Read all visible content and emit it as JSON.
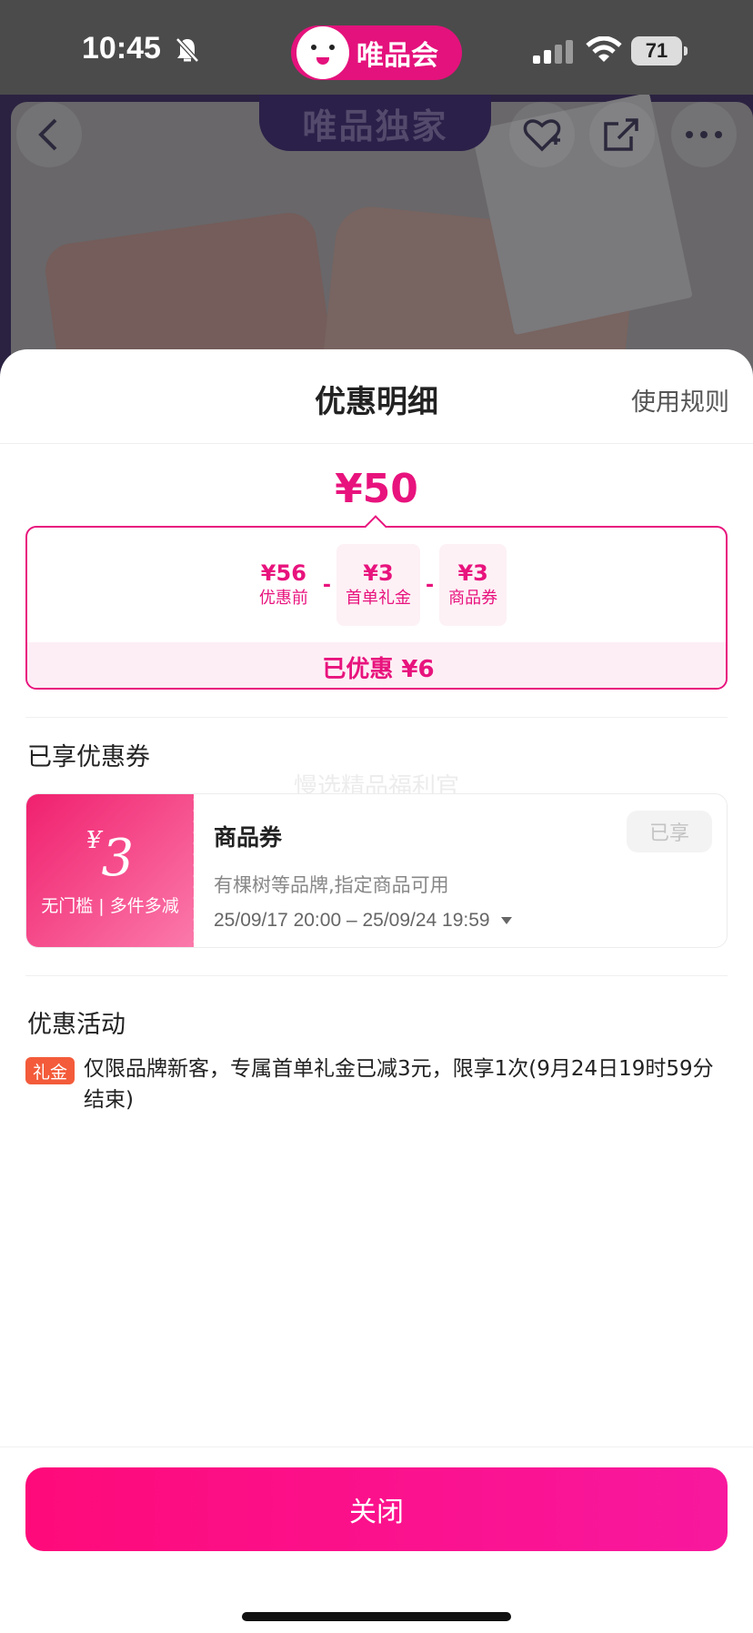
{
  "status_bar": {
    "time": "10:45",
    "app_name": "唯品会",
    "battery": "71"
  },
  "background_page": {
    "banner_tag": "唯品独家",
    "icons": [
      "back-icon",
      "favorite-add-icon",
      "share-icon",
      "more-icon"
    ]
  },
  "sheet": {
    "title": "优惠明细",
    "rules_link": "使用规则",
    "final_price": "¥50",
    "breakdown": {
      "items": [
        {
          "amount": "¥56",
          "label": "优惠前"
        },
        {
          "amount": "¥3",
          "label": "首单礼金"
        },
        {
          "amount": "¥3",
          "label": "商品券"
        }
      ],
      "operator": "-",
      "saved": "已优惠 ¥6"
    },
    "coupons_section": {
      "title": "已享优惠券",
      "watermark": "慢选精品福利官",
      "coupon": {
        "currency": "¥",
        "amount": "3",
        "condition": "无门槛 | 多件多减",
        "name": "商品券",
        "badge": "已享",
        "description": "有棵树等品牌,指定商品可用",
        "validity": "25/09/17 20:00 – 25/09/24 19:59"
      }
    },
    "activity_section": {
      "title": "优惠活动",
      "tag": "礼金",
      "text": "仅限品牌新客，专属首单礼金已减3元，限享1次(9月24日19时59分结束)"
    },
    "close_button": "关闭"
  },
  "colors": {
    "accent": "#e8137d",
    "activity_tag": "#f35b3a",
    "status_bar": "#4b4b4b"
  }
}
